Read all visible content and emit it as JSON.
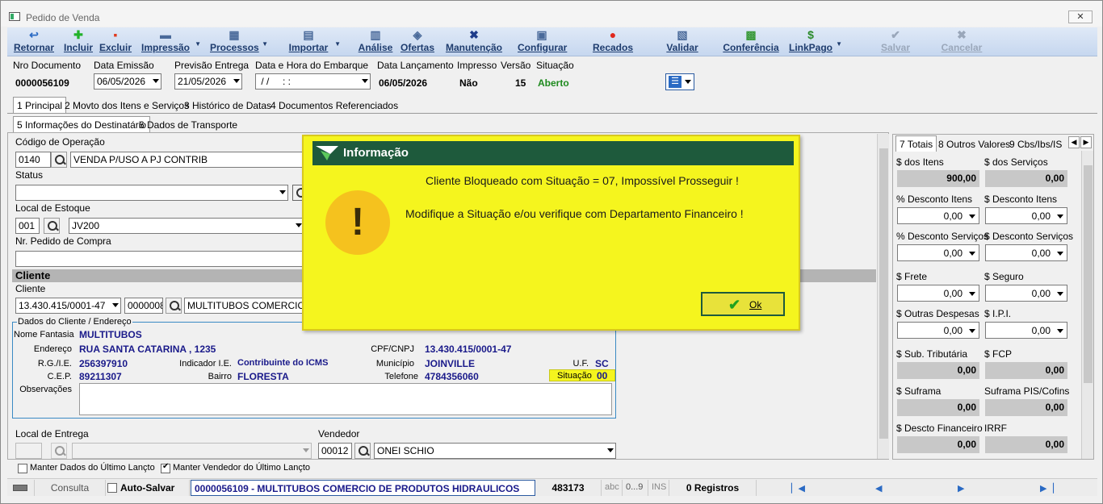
{
  "window": {
    "title": "Pedido de Venda",
    "close": "✕"
  },
  "toolbar": [
    {
      "label": "Retornar",
      "icon": "↩"
    },
    {
      "label": "Incluir",
      "icon": "✚"
    },
    {
      "label": "Excluir",
      "icon": "▪"
    },
    {
      "label": "Impressão",
      "icon": "▬"
    },
    {
      "label": "Processos",
      "icon": "▦"
    },
    {
      "label": "Importar",
      "icon": "▤"
    },
    {
      "label": "Análise",
      "icon": "▥"
    },
    {
      "label": "Ofertas",
      "icon": "◈"
    },
    {
      "label": "Manutenção",
      "icon": "✖"
    },
    {
      "label": "Configurar",
      "icon": "▣"
    },
    {
      "label": "Recados",
      "icon": "●"
    },
    {
      "label": "Validar",
      "icon": "▧"
    },
    {
      "label": "Conferência",
      "icon": "▩"
    },
    {
      "label": "LinkPago",
      "icon": "$"
    },
    {
      "label": "Salvar",
      "icon": "✔"
    },
    {
      "label": "Cancelar",
      "icon": "✖"
    }
  ],
  "header": {
    "nro_documento_label": "Nro Documento",
    "nro_documento": "0000056109",
    "data_emissao_label": "Data Emissão",
    "data_emissao": "06/05/2026",
    "previsao_label": "Previsão Entrega",
    "previsao": "21/05/2026",
    "embarque_label": "Data e Hora do Embarque",
    "embarque": " / /     : :",
    "lancamento_label": "Data Lançamento",
    "lancamento": "06/05/2026",
    "impresso_label": "Impresso",
    "impresso": "Não",
    "versao_label": "Versão",
    "versao": "15",
    "situacao_label": "Situação",
    "situacao": "Aberto"
  },
  "tabs1": [
    "1 Principal",
    "2 Movto dos Itens e Serviços",
    "3 Histórico de Datas",
    "4 Documentos Referenciados"
  ],
  "tabs2": [
    "5 Informações do Destinatário",
    "6 Dados de Transporte"
  ],
  "form": {
    "cod_operacao_label": "Código de Operação",
    "cod_operacao": "0140",
    "cod_operacao_desc": "VENDA P/USO A PJ CONTRIB",
    "status_label": "Status",
    "status": "",
    "local_estoque_label": "Local de Estoque",
    "local_estoque": "001",
    "local_estoque_desc": "JV200",
    "pedido_compra_label": "Nr. Pedido de Compra",
    "pedido_compra": "",
    "cliente_section": "Cliente",
    "cliente_label": "Cliente",
    "cliente_cnpj": "13.430.415/0001-47",
    "cliente_code": "0000008",
    "cliente_nome": "MULTITUBOS COMERCIO DE",
    "dados_title": "Dados do Cliente / Endereço",
    "nome_fantasia_label": "Nome Fantasia",
    "nome_fantasia": "MULTITUBOS",
    "endereco_label": "Endereço",
    "endereco": "RUA SANTA CATARINA , 1235",
    "cpf_label": "CPF/CNPJ",
    "cpf": "13.430.415/0001-47",
    "rg_label": "R.G./I.E.",
    "rg": "256397910",
    "indicador_label": "Indicador I.E.",
    "indicador": "Contribuinte do ICMS",
    "municipio_label": "Município",
    "municipio": "JOINVILLE",
    "uf_label": "U.F.",
    "uf": "SC",
    "cep_label": "C.E.P.",
    "cep": "89211307",
    "bairro_label": "Bairro",
    "bairro": "FLORESTA",
    "telefone_label": "Telefone",
    "telefone": "4784356060",
    "situacao_label": "Situação",
    "situacao": "00",
    "obs_label": "Observações",
    "local_entrega_label": "Local de Entrega",
    "vendedor_label": "Vendedor",
    "vendedor_code": "00012",
    "vendedor_nome": "ONEI SCHIO",
    "manter_dados": "Manter Dados do Último Lançto",
    "manter_vendedor": "Manter Vendedor do Último Lançto"
  },
  "right": {
    "tabs": [
      "7 Totais",
      "8 Outros Valores",
      "9 Cbs/Ibs/IS"
    ],
    "fields": [
      {
        "label": "$ dos Itens",
        "value": "900,00",
        "ro": true
      },
      {
        "label": "$ dos Serviços",
        "value": "0,00",
        "ro": true
      },
      {
        "label": "% Desconto Itens",
        "value": "0,00",
        "ro": false
      },
      {
        "label": "$ Desconto Itens",
        "value": "0,00",
        "ro": false
      },
      {
        "label": "% Desconto Serviços",
        "value": "0,00",
        "ro": false
      },
      {
        "label": "$ Desconto Serviços",
        "value": "0,00",
        "ro": false
      },
      {
        "label": "$ Frete",
        "value": "0,00",
        "ro": false
      },
      {
        "label": "$ Seguro",
        "value": "0,00",
        "ro": false
      },
      {
        "label": "$ Outras Despesas",
        "value": "0,00",
        "ro": false
      },
      {
        "label": "$ I.P.I.",
        "value": "0,00",
        "ro": false
      },
      {
        "label": "$ Sub. Tributária",
        "value": "0,00",
        "ro": true
      },
      {
        "label": "$ FCP",
        "value": "0,00",
        "ro": true
      },
      {
        "label": "$ Suframa",
        "value": "0,00",
        "ro": true
      },
      {
        "label": "Suframa PIS/Cofins",
        "value": "0,00",
        "ro": true
      },
      {
        "label": "$ Descto Financeiro",
        "value": "0,00",
        "ro": true
      },
      {
        "label": "IRRF",
        "value": "0,00",
        "ro": true
      }
    ]
  },
  "statusbar": {
    "mode": "Consulta",
    "auto_salvar": "Auto-Salvar",
    "info": "0000056109 - MULTITUBOS COMERCIO DE PRODUTOS HIDRAULICOS",
    "code": "483173",
    "abc": "abc",
    "range": "0...9",
    "ins": "INS",
    "registros": "0 Registros"
  },
  "dialog": {
    "title": "Informação",
    "msg1": "Cliente Bloqueado com Situação = 07, Impossível Prosseguir !",
    "msg2": "Modifique a Situação e/ou verifique com Departamento Financeiro !",
    "ok": "Ok"
  },
  "colors": {
    "toolbar_text": "#1e3c6e",
    "aberto": "#1e8a1e",
    "dialog_bg": "#f5f51e",
    "dialog_head": "#1e5a3c",
    "data_blue": "#1a1a8a"
  }
}
